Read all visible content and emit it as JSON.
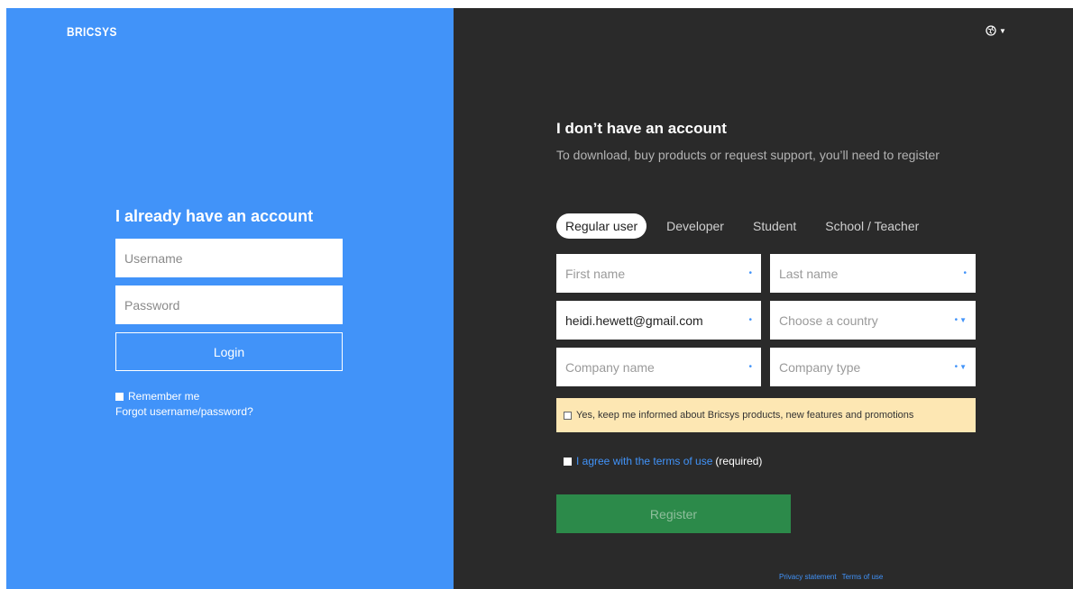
{
  "brand": {
    "logo_text": "BRICSYS"
  },
  "login": {
    "title": "I already have an account",
    "username_placeholder": "Username",
    "password_placeholder": "Password",
    "login_label": "Login",
    "remember_label": "Remember me",
    "forgot_label": "Forgot username/password?"
  },
  "register": {
    "title": "I don’t have an account",
    "subtitle": "To download, buy products or request support, you’ll need to register",
    "tabs": [
      {
        "label": "Regular user",
        "active": true
      },
      {
        "label": "Developer",
        "active": false
      },
      {
        "label": "Student",
        "active": false
      },
      {
        "label": "School / Teacher",
        "active": false
      }
    ],
    "fields": {
      "first_name": "First name",
      "last_name": "Last name",
      "email_value": "heidi.hewett@gmail.com",
      "country": "Choose a country",
      "company_name": "Company name",
      "company_type": "Company type"
    },
    "newsletter_label": "Yes, keep me informed about Bricsys products, new features and promotions",
    "agree_link": "I agree with the terms of use",
    "agree_suffix": "(required)",
    "register_label": "Register"
  },
  "footer": {
    "privacy": "Privacy statement",
    "terms": "Terms of use"
  },
  "colors": {
    "left_panel": "#4193f9",
    "right_panel": "#2a2a2a",
    "register_button": "#2c8a4a",
    "newsletter_bg": "#fde7b3"
  },
  "icons": {
    "language": "globe-icon",
    "dropdown": "caret-down-icon"
  }
}
